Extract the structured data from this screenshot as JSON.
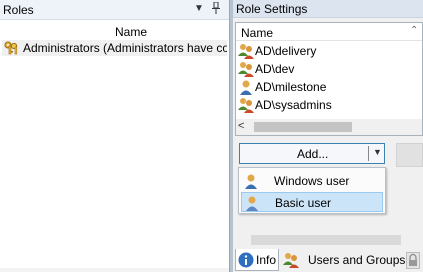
{
  "roles": {
    "title": "Roles",
    "column_name": "Name",
    "items": [
      {
        "label": "Administrators (Administrators have co",
        "icon": "keys-icon"
      }
    ]
  },
  "settings": {
    "title": "Role Settings",
    "column_name": "Name",
    "users": [
      {
        "name": "AD\\delivery",
        "icon": "group-icon"
      },
      {
        "name": "AD\\dev",
        "icon": "group-icon"
      },
      {
        "name": "AD\\milestone",
        "icon": "user-icon"
      },
      {
        "name": "AD\\sysadmins",
        "icon": "group-icon"
      }
    ],
    "add_button_label": "Add...",
    "add_menu": [
      {
        "label": "Windows user",
        "icon": "user-icon",
        "selected": false
      },
      {
        "label": "Basic user",
        "icon": "basic-user-icon",
        "selected": true
      }
    ],
    "tabs": [
      {
        "label": "Info",
        "icon": "info-icon",
        "active": true
      },
      {
        "label": "Users and Groups",
        "icon": "group-icon",
        "active": false
      }
    ]
  },
  "colors": {
    "selection_fill": "#cce4f7",
    "selection_border": "#99c9ef",
    "button_border": "#3c7fb1"
  }
}
